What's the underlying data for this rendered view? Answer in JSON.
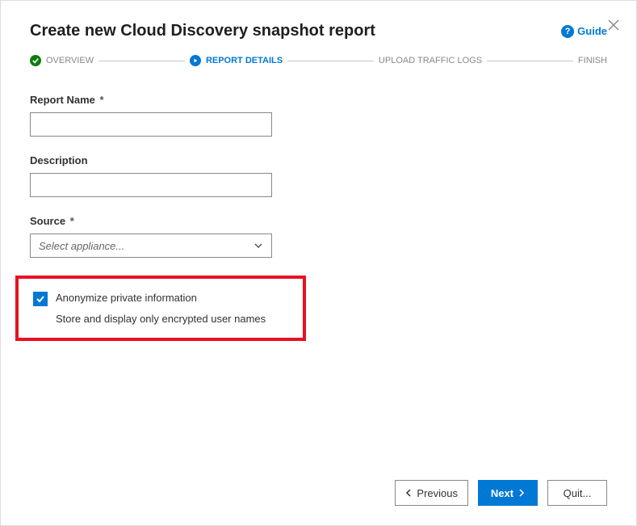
{
  "header": {
    "title": "Create new Cloud Discovery snapshot report",
    "guide_label": "Guide"
  },
  "stepper": {
    "steps": [
      {
        "label": "OVERVIEW",
        "state": "done"
      },
      {
        "label": "REPORT DETAILS",
        "state": "active"
      },
      {
        "label": "UPLOAD TRAFFIC LOGS",
        "state": "pending"
      },
      {
        "label": "FINISH",
        "state": "pending"
      }
    ]
  },
  "form": {
    "report_name": {
      "label": "Report Name",
      "required": true,
      "value": ""
    },
    "description": {
      "label": "Description",
      "required": false,
      "value": ""
    },
    "source": {
      "label": "Source",
      "required": true,
      "placeholder": "Select appliance...",
      "selected": ""
    },
    "anonymize": {
      "checked": true,
      "label": "Anonymize private information",
      "description": "Store and display only encrypted user names"
    }
  },
  "footer": {
    "previous": "Previous",
    "next": "Next",
    "quit": "Quit..."
  },
  "required_mark": "*"
}
